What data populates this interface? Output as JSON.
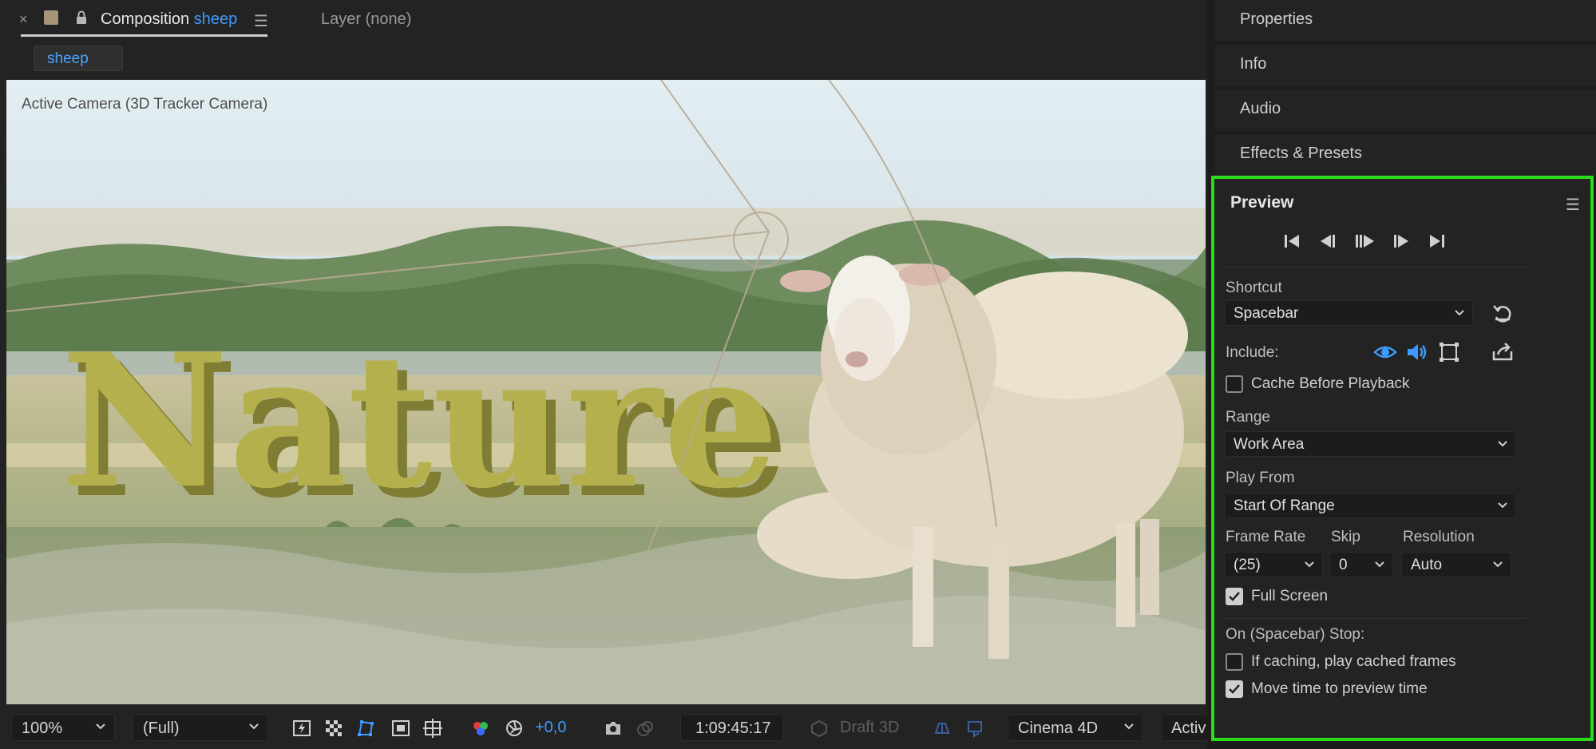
{
  "composition_tab": {
    "close_glyph": "×",
    "title_prefix": "Composition",
    "comp_name": "sheep",
    "menu_glyph": "☰",
    "layer_tab": "Layer (none)",
    "breadcrumb": "sheep",
    "swatch_color": "#a89478"
  },
  "viewer": {
    "camera_label": "Active Camera (3D Tracker Camera)",
    "title_text": "Nature",
    "title_color": "#b5b04e"
  },
  "footer": {
    "zoom": "100%",
    "resolution": "(Full)",
    "exposure": "+0,0",
    "timecode": "1:09:45:17",
    "draft3d": "Draft 3D",
    "renderer": "Cinema 4D",
    "view": "Activ"
  },
  "panels": {
    "properties": "Properties",
    "info": "Info",
    "audio": "Audio",
    "effects": "Effects & Presets"
  },
  "preview": {
    "title": "Preview",
    "menu_glyph": "☰",
    "shortcut_label": "Shortcut",
    "shortcut_value": "Spacebar",
    "include_label": "Include:",
    "cache_before": "Cache Before Playback",
    "range_label": "Range",
    "range_value": "Work Area",
    "play_from_label": "Play From",
    "play_from_value": "Start Of Range",
    "frame_rate_label": "Frame Rate",
    "frame_rate_value": "(25)",
    "skip_label": "Skip",
    "skip_value": "0",
    "resolution_label": "Resolution",
    "resolution_value": "Auto",
    "full_screen": "Full Screen",
    "on_stop_label": "On (Spacebar) Stop:",
    "if_caching": "If caching, play cached frames",
    "move_time": "Move time to preview time",
    "accent_color": "#3d9bff",
    "highlight_color": "#2bdc1c"
  }
}
